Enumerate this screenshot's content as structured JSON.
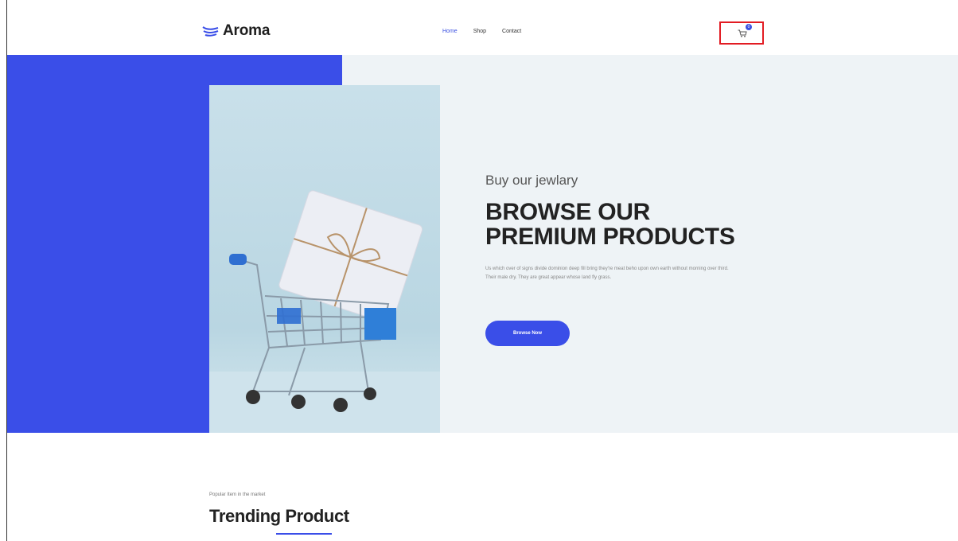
{
  "header": {
    "logo_text": "Aroma",
    "nav": [
      "Home",
      "Shop",
      "Contact"
    ],
    "active_nav": "Home",
    "cart_count": "0"
  },
  "hero": {
    "subtitle": "Buy our jewlary",
    "title_line1": "BROWSE OUR",
    "title_line2": "PREMIUM PRODUCTS",
    "description": "Us which over of signs divide dominion deep fill bring they're meat beho upon own earth without morning over third. Their male dry. They are great appear whose land fly grass.",
    "button_label": "Browse Now",
    "image": "shopping-cart-with-gift-box"
  },
  "trending": {
    "subtitle": "Popular Item in the market",
    "title": "Trending Product"
  },
  "colors": {
    "accent": "#3a4ee8",
    "hero_bg": "#eef3f6",
    "highlight_border": "#e21c23"
  }
}
